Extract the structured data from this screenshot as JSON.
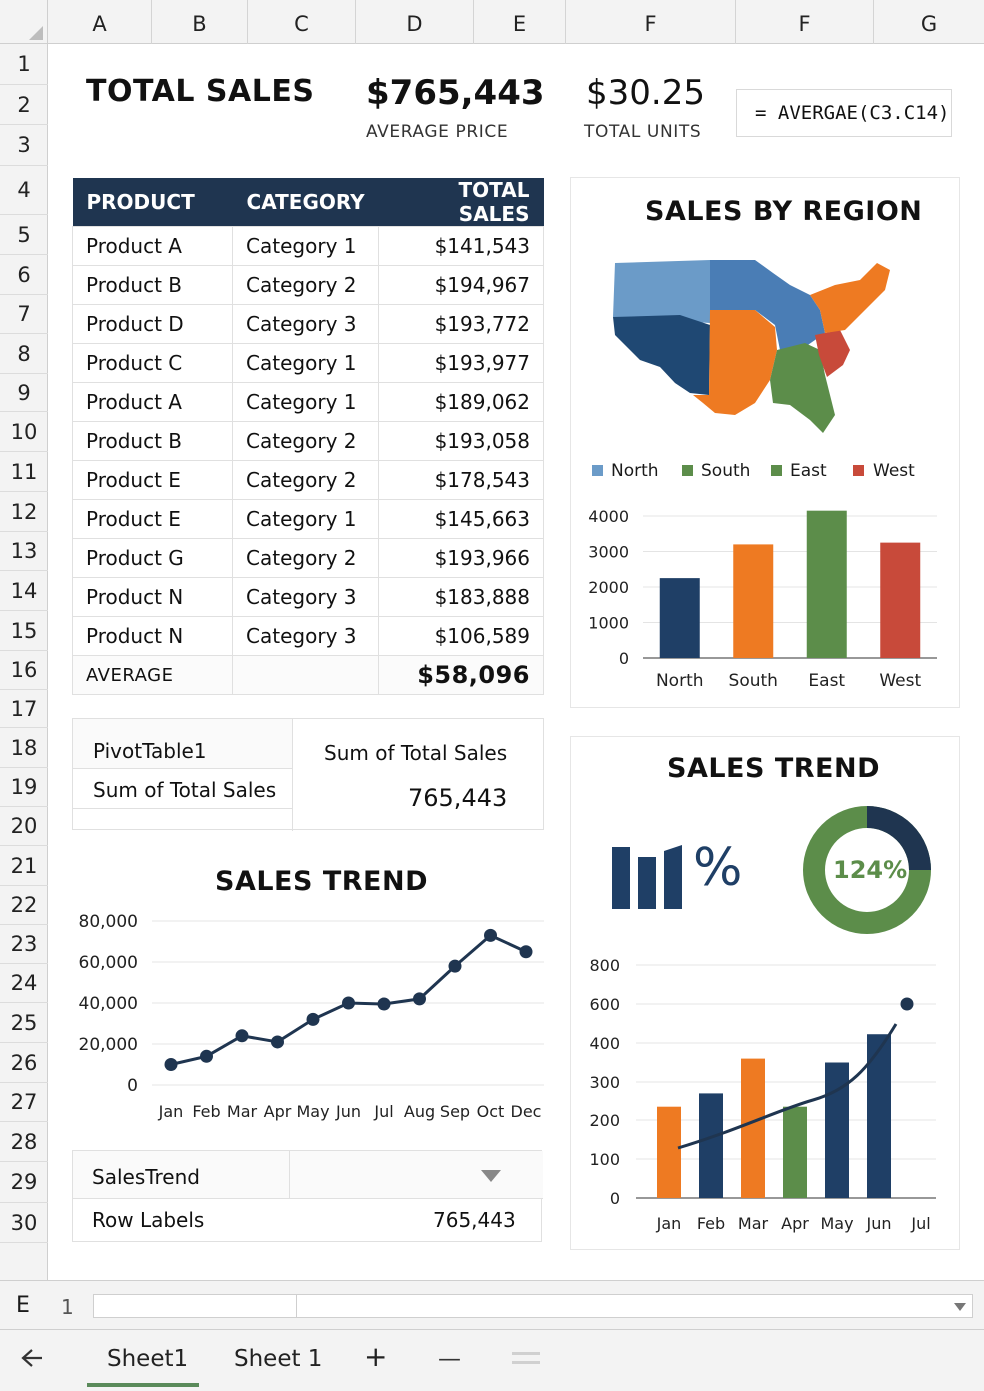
{
  "columns": [
    "A",
    "B",
    "C",
    "D",
    "E",
    "F",
    "F",
    "G"
  ],
  "rows": [
    "1",
    "2",
    "3",
    "4",
    "5",
    "6",
    "7",
    "8",
    "9",
    "10",
    "11",
    "12",
    "13",
    "14",
    "15",
    "16",
    "17",
    "18",
    "19",
    "20",
    "21",
    "22",
    "23",
    "24",
    "25",
    "26",
    "27",
    "28",
    "29",
    "30"
  ],
  "kpi": {
    "title": "TOTAL SALES",
    "total_value": "$765,443",
    "total_label": "AVERAGE PRICE",
    "units_value": "$30.25",
    "units_label": "TOTAL UNITS",
    "formula": "= AVERGAE(C3.C14)"
  },
  "product_table": {
    "headers": [
      "PRODUCT",
      "CATEGORY",
      "TOTAL SALES"
    ],
    "rows": [
      [
        "Product A",
        "Category 1",
        "$141,543"
      ],
      [
        "Product B",
        "Category 2",
        "$194,967"
      ],
      [
        "Product D",
        "Category 3",
        "$193,772"
      ],
      [
        "Product C",
        "Category 1",
        "$193,977"
      ],
      [
        "Product A",
        "Category 1",
        "$189,062"
      ],
      [
        "Product B",
        "Category 2",
        "$193,058"
      ],
      [
        "Product E",
        "Category 2",
        "$178,543"
      ],
      [
        "Product E",
        "Category 1",
        "$145,663"
      ],
      [
        "Product G",
        "Category 2",
        "$193,966"
      ],
      [
        "Product N",
        "Category 3",
        "$183,888"
      ],
      [
        "Product N",
        "Category 3",
        "$106,589"
      ]
    ],
    "footer_label": "AVERAGE",
    "footer_value": "$58,096"
  },
  "region_panel": {
    "title": "SALES BY REGION",
    "legend": [
      "North",
      "South",
      "East",
      "West"
    ]
  },
  "pivot": {
    "name": "PivotTable1",
    "row_label": "Sum of Total Sales",
    "header": "Sum of Total Sales",
    "value": "765,443"
  },
  "trend_left": {
    "title": "SALES TREND"
  },
  "trend_right": {
    "title": "SALES TREND",
    "percent_symbol": "%",
    "donut_label": "124%"
  },
  "sales_trend_table": {
    "name": "SalesTrend",
    "row_label": "Row Labels",
    "value": "765,443"
  },
  "sheet_bar": {
    "name_box": "E",
    "row_indicator": "1",
    "tabs": [
      "Sheet1",
      "Sheet 1"
    ],
    "add": "+",
    "minus": "—"
  },
  "colors": {
    "navy": "#1f3f66",
    "orange": "#ee7a22",
    "green": "#5c8d4a",
    "red": "#c84a3a",
    "light_blue": "#6b9bc8",
    "header": "#1f3550"
  },
  "chart_data": [
    {
      "type": "bar",
      "categories": [
        "North",
        "South",
        "East",
        "West"
      ],
      "values": [
        2250,
        3200,
        4150,
        3250
      ],
      "ylim": [
        0,
        4000
      ],
      "yticks": [
        0,
        1000,
        2000,
        3000,
        4000
      ],
      "colors": [
        "#1f3f66",
        "#ee7a22",
        "#5c8d4a",
        "#c84a3a"
      ],
      "grid": true
    },
    {
      "type": "line",
      "title": "SALES TREND",
      "categories": [
        "Jan",
        "Feb",
        "Mar",
        "Apr",
        "May",
        "Jun",
        "Jul",
        "Aug",
        "Sep",
        "Oct",
        "Dec"
      ],
      "values": [
        10000,
        14000,
        24000,
        21000,
        32000,
        40000,
        39500,
        42000,
        58000,
        73000,
        65000
      ],
      "ylim": [
        0,
        80000
      ],
      "yticks": [
        "0",
        "20,000",
        "40,000",
        "60,000",
        "80,000"
      ],
      "grid": true
    },
    {
      "type": "bar",
      "categories": [
        "Jan",
        "Feb",
        "Mar",
        "Apr",
        "May",
        "Jun",
        "Jul"
      ],
      "values": [
        235,
        270,
        360,
        235,
        350,
        445,
        600
      ],
      "colors": [
        "#ee7a22",
        "#1f3f66",
        "#ee7a22",
        "#5c8d4a",
        "#1f3f66",
        "#1f3f66",
        "#1f3f66"
      ],
      "yticks": [
        "0",
        "100",
        "200",
        "300",
        "400",
        "600",
        "800"
      ],
      "trend_line": true,
      "grid": true
    }
  ]
}
